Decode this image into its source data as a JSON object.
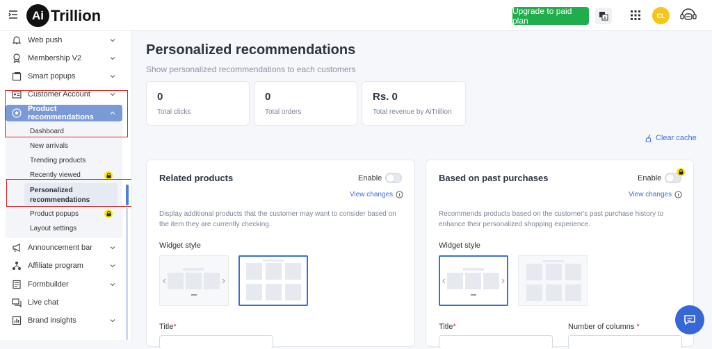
{
  "app": {
    "logo_mark": "Ai",
    "logo_text": "Trillion"
  },
  "header": {
    "upgrade_label": "Upgrade to paid plan",
    "avatar_initials": "CL"
  },
  "sidebar": {
    "items": [
      {
        "label": "Web push"
      },
      {
        "label": "Membership V2"
      },
      {
        "label": "Smart popups"
      },
      {
        "label": "Customer Account"
      },
      {
        "label": "Product recommendations"
      },
      {
        "label": "Announcement bar"
      },
      {
        "label": "Affiliate program"
      },
      {
        "label": "Formbuilder"
      },
      {
        "label": "Live chat"
      },
      {
        "label": "Brand insights"
      }
    ],
    "sub_items": [
      {
        "label": "Dashboard"
      },
      {
        "label": "New arrivals"
      },
      {
        "label": "Trending products"
      },
      {
        "label": "Recently viewed"
      },
      {
        "label": "Personalized recommendations"
      },
      {
        "label": "Product popups"
      },
      {
        "label": "Layout settings"
      }
    ]
  },
  "main": {
    "title": "Personalized recommendations",
    "subtitle": "Show personalized recommendations to each customers",
    "stats": [
      {
        "value": "0",
        "label": "Total clicks"
      },
      {
        "value": "0",
        "label": "Total orders"
      },
      {
        "value": "Rs. 0",
        "label": "Total revenue by AiTrillion"
      }
    ],
    "clear_cache": "Clear cache",
    "cards": [
      {
        "title": "Related products",
        "enable_label": "Enable",
        "view_changes": "View changes",
        "description": "Display additional products that the customer may want to consider based on the item they are currently checking.",
        "widget_style_label": "Widget style",
        "fields": [
          {
            "label": "Title"
          }
        ]
      },
      {
        "title": "Based on past purchases",
        "enable_label": "Enable",
        "view_changes": "View changes",
        "description": "Recommends products based on the customer's past purchase history to enhance their personalized shopping experience.",
        "widget_style_label": "Widget style",
        "fields": [
          {
            "label": "Title"
          },
          {
            "label": "Number of columns"
          }
        ]
      }
    ]
  },
  "colors": {
    "accent": "#3a6fd8",
    "upgrade": "#1fae4b",
    "active_sidebar": "#7a9ad6",
    "lock": "#ffe600",
    "highlight": "#e02020"
  }
}
